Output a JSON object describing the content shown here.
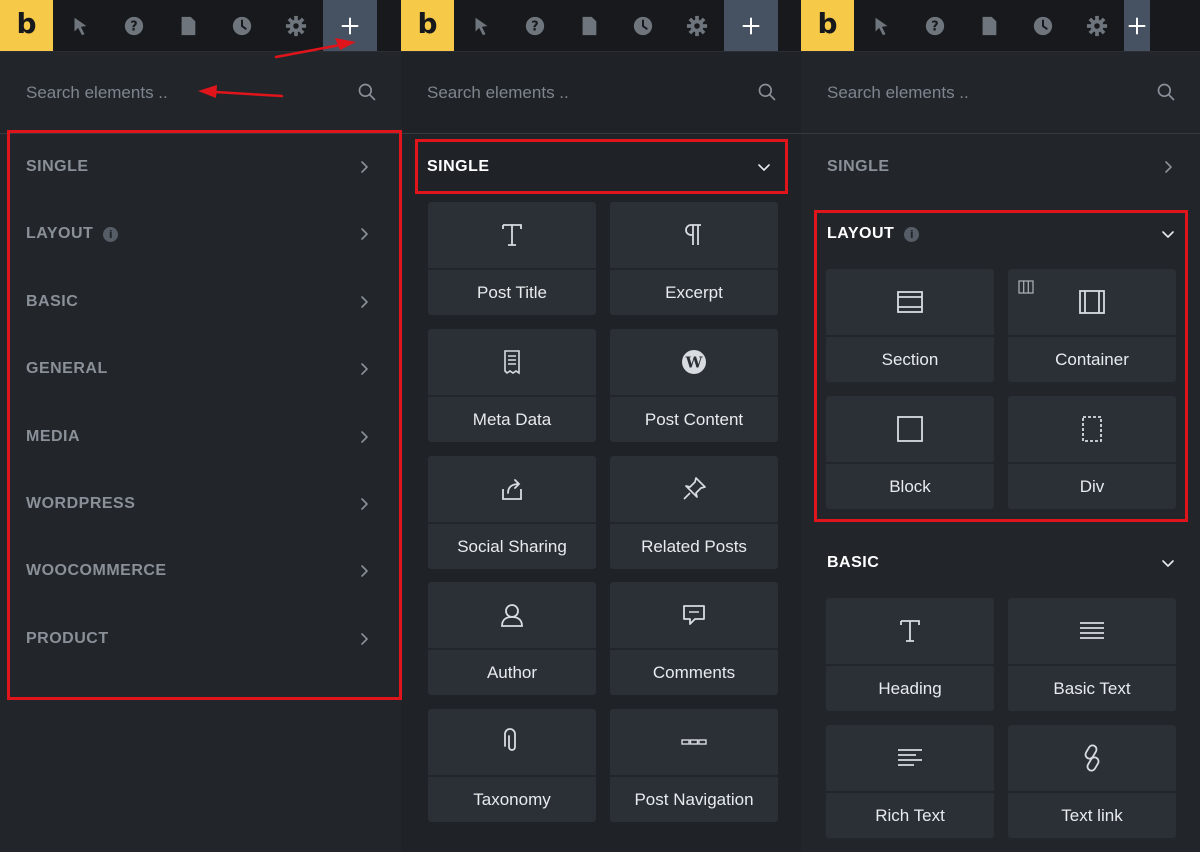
{
  "panels": [
    {
      "logo": "b",
      "toolbar_icons": [
        "cursor-icon",
        "help-icon",
        "page-icon",
        "history-icon",
        "settings-icon",
        "add-icon"
      ],
      "search_placeholder": "Search elements ..",
      "categories": [
        "SINGLE",
        "LAYOUT",
        "BASIC",
        "GENERAL",
        "MEDIA",
        "WORDPRESS",
        "WOOCOMMERCE",
        "PRODUCT"
      ]
    },
    {
      "logo": "b",
      "toolbar_icons": [
        "cursor-icon",
        "help-icon",
        "page-icon",
        "history-icon",
        "settings-icon",
        "add-icon"
      ],
      "search_placeholder": "Search elements ..",
      "open_category": "SINGLE",
      "elements": [
        {
          "label": "Post Title",
          "icon": "title-t-icon"
        },
        {
          "label": "Excerpt",
          "icon": "pilcrow-icon"
        },
        {
          "label": "Meta Data",
          "icon": "receipt-icon"
        },
        {
          "label": "Post Content",
          "icon": "wordpress-icon"
        },
        {
          "label": "Social Sharing",
          "icon": "share-icon"
        },
        {
          "label": "Related Posts",
          "icon": "pin-icon"
        },
        {
          "label": "Author",
          "icon": "user-icon"
        },
        {
          "label": "Comments",
          "icon": "comments-icon"
        },
        {
          "label": "Taxonomy",
          "icon": "paperclip-icon"
        },
        {
          "label": "Post Navigation",
          "icon": "dots-navigation-icon"
        }
      ]
    },
    {
      "logo": "b",
      "toolbar_icons": [
        "cursor-icon",
        "help-icon",
        "page-icon",
        "history-icon",
        "settings-icon",
        "add-icon"
      ],
      "search_placeholder": "Search elements ..",
      "collapsed_category": "SINGLE",
      "layout_category": "LAYOUT",
      "layout_elements": [
        {
          "label": "Section",
          "icon": "section-icon"
        },
        {
          "label": "Container",
          "icon": "container-icon"
        },
        {
          "label": "Block",
          "icon": "block-icon"
        },
        {
          "label": "Div",
          "icon": "div-icon"
        }
      ],
      "basic_category": "BASIC",
      "basic_elements": [
        {
          "label": "Heading",
          "icon": "heading-icon"
        },
        {
          "label": "Basic Text",
          "icon": "text-lines-icon"
        },
        {
          "label": "Rich Text",
          "icon": "rich-text-icon"
        },
        {
          "label": "Text link",
          "icon": "link-icon"
        }
      ]
    }
  ],
  "colors": {
    "brand_yellow": "#f7c948",
    "highlight_red": "#e0141b",
    "active_toolbar": "#465161"
  }
}
